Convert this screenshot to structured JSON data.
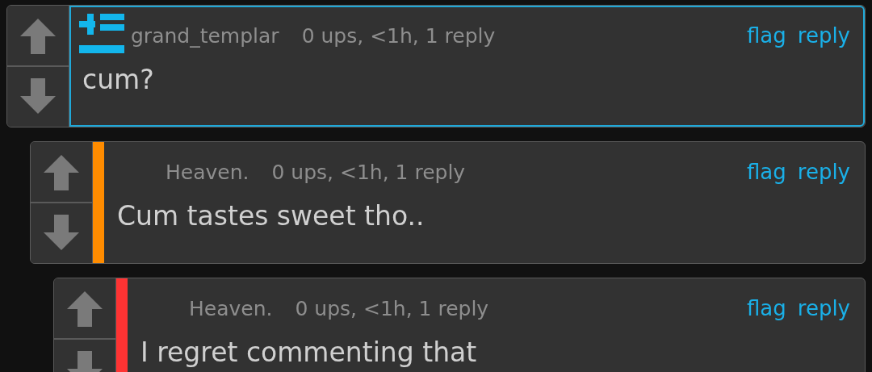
{
  "comments": [
    {
      "author": "grand_templar",
      "meta": "0 ups, <1h, 1 reply",
      "flag": "flag",
      "reply": "reply",
      "text": "cum?",
      "highlighted": true,
      "avatar": true
    },
    {
      "author": "Heaven.",
      "meta": "0 ups, <1h, 1 reply",
      "flag": "flag",
      "reply": "reply",
      "text": "Cum tastes sweet tho..",
      "highlighted": false,
      "avatar": false,
      "color": "#ff8c00"
    },
    {
      "author": "Heaven.",
      "meta": "0 ups, <1h, 1 reply",
      "flag": "flag",
      "reply": "reply",
      "text": "I regret commenting that",
      "highlighted": false,
      "avatar": false,
      "color": "#ff3333"
    }
  ]
}
